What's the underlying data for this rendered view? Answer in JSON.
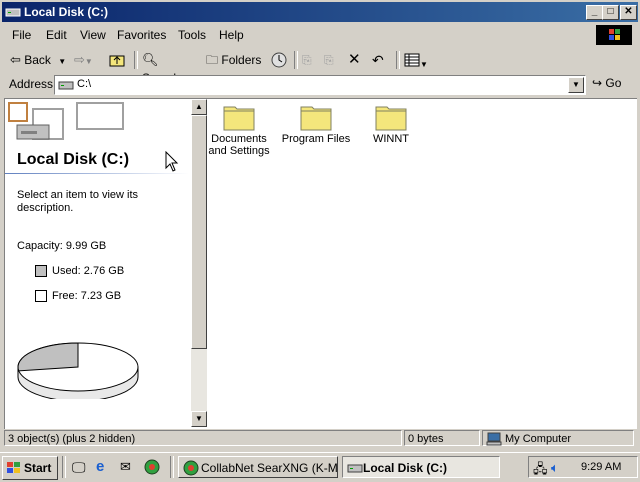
{
  "window": {
    "title": "Local Disk (C:)",
    "min_label": "_",
    "max_label": "□",
    "close_label": "✕"
  },
  "menu": [
    "File",
    "Edit",
    "View",
    "Favorites",
    "Tools",
    "Help"
  ],
  "toolbar": {
    "back": "Back",
    "search": "Search",
    "folders": "Folders"
  },
  "address": {
    "label": "Address",
    "value": "C:\\",
    "go": "Go"
  },
  "left_pane": {
    "title": "Local Disk (C:)",
    "description": "Select an item to view its description.",
    "capacity": "Capacity: 9.99 GB",
    "used": "Used: 2.76 GB",
    "free": "Free: 7.23 GB",
    "used_fraction": 0.276
  },
  "folders": [
    {
      "name": "Documents and Settings"
    },
    {
      "name": "Program Files"
    },
    {
      "name": "WINNT"
    }
  ],
  "status": {
    "objects": "3 object(s) (plus 2 hidden)",
    "size": "0 bytes",
    "zone": "My Computer"
  },
  "taskbar": {
    "start": "Start",
    "tasks": [
      "CollabNet SearXNG (K-Mel...",
      "Local Disk (C:)"
    ],
    "clock": "9:29 AM"
  },
  "colors": {
    "title_bar": "#0a246a",
    "folder_yellow": "#f4e67c",
    "chrome": "#d4d0c8"
  }
}
